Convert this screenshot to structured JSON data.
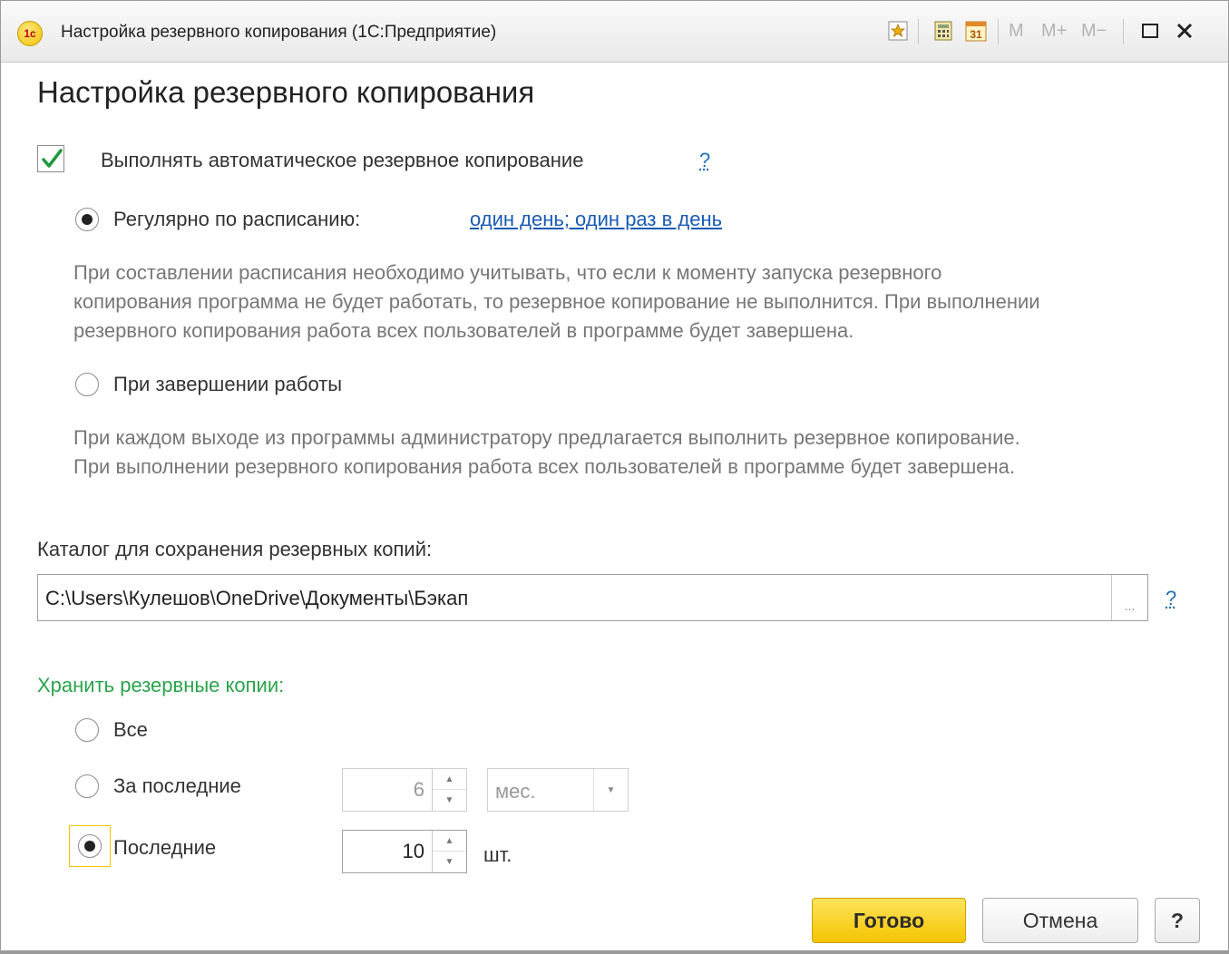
{
  "window": {
    "title": "Настройка резервного копирования  (1С:Предприятие)",
    "logo_text": "1c",
    "toolbar": {
      "m_label": "M",
      "m_plus_label": "M+",
      "m_minus_label": "M−",
      "calendar_day": "31"
    }
  },
  "form": {
    "title": "Настройка резервного копирования",
    "auto_backup": {
      "label": "Выполнять автоматическое резервное копирование",
      "checked": true,
      "help": "?"
    },
    "schedule_option": {
      "label": "Регулярно по расписанию:",
      "selected": true,
      "link": "один день; один раз в день",
      "hint_lines": [
        "При составлении расписания необходимо учитывать, что если к моменту запуска резервного",
        "копирования программа не будет работать, то резервное копирование не выполнится. При выполнении",
        "резервного копирования работа всех пользователей в программе будет завершена."
      ]
    },
    "shutdown_option": {
      "label": "При завершении работы",
      "selected": false,
      "hint_lines": [
        "При каждом выходе из программы администратору предлагается выполнить резервное копирование.",
        "При выполнении резервного копирования работа всех пользователей в программе будет завершена."
      ]
    },
    "directory": {
      "label": "Каталог для сохранения резервных копий:",
      "value": "C:\\Users\\Кулешов\\OneDrive\\Документы\\Бэкап",
      "browse": "...",
      "help": "?"
    },
    "keep": {
      "label": "Хранить резервные копии:",
      "all": {
        "label": "Все",
        "selected": false
      },
      "last_period": {
        "label": "За последние",
        "selected": false,
        "value": "6",
        "unit": "мес."
      },
      "last_count": {
        "label": "Последние",
        "selected": true,
        "value": "10",
        "unit": "шт."
      }
    }
  },
  "buttons": {
    "ok": "Готово",
    "cancel": "Отмена",
    "help": "?"
  },
  "colors": {
    "accent_yellow": "#f4c400",
    "link_blue": "#1a5bb5",
    "group_green": "#2aa44c",
    "check_green": "#1e9a3c"
  }
}
